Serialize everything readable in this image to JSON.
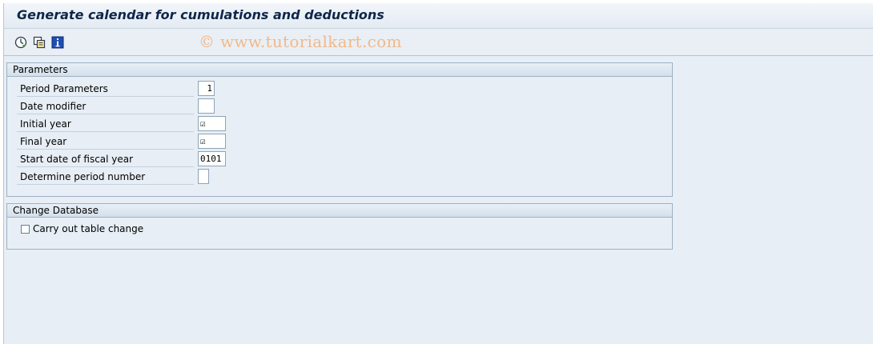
{
  "window": {
    "title": "Generate calendar for cumulations and deductions"
  },
  "toolbar": {
    "buttons": [
      {
        "icon": "execute-icon",
        "tooltip": "Execute"
      },
      {
        "icon": "variant-icon",
        "tooltip": "Get Variant"
      },
      {
        "icon": "info-icon",
        "tooltip": "Program documentation"
      }
    ],
    "watermark": "© www.tutorialkart.com"
  },
  "parameters": {
    "title": "Parameters",
    "fields": [
      {
        "label": "Period Parameters",
        "value": "1"
      },
      {
        "label": "Date modifier",
        "value": ""
      },
      {
        "label": "Initial year",
        "value": "☑"
      },
      {
        "label": "Final year",
        "value": "☑"
      },
      {
        "label": "Start date of fiscal year",
        "value": "0101"
      },
      {
        "label": "Determine period number",
        "value": ""
      }
    ]
  },
  "change_database": {
    "title": "Change Database",
    "checkbox_label": "Carry out table change",
    "checked": false
  },
  "colors": {
    "background": "#e7eef5",
    "title_text": "#10264a",
    "group_border": "#9fb1c3",
    "watermark": "#f2b98a"
  }
}
